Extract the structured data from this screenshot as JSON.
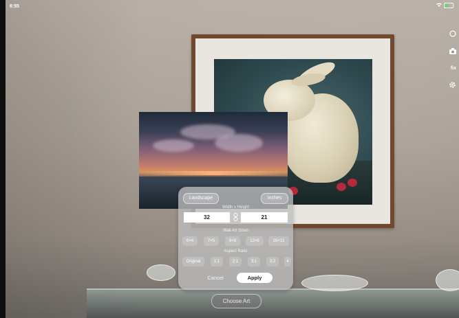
{
  "status_bar": {
    "time": "6:55"
  },
  "dialog": {
    "orientation_label": "Landscape",
    "units_label": "Inches",
    "size_section_label": "Width x Height",
    "width_value": "32",
    "height_value": "21",
    "wall_art_sizes_label": "Wall Art Sizes",
    "wall_art_sizes": [
      "6×4",
      "7×5",
      "8×8",
      "12×8",
      "16×12"
    ],
    "aspect_ratio_label": "Aspect Ratio",
    "aspect_ratios": [
      "Original",
      "1:1",
      "2:1",
      "3:1",
      "3:2",
      "4"
    ],
    "cancel_label": "Cancel",
    "apply_label": "Apply"
  },
  "choose_art_label": "Choose Art",
  "side_tools": {
    "label": "fix"
  },
  "icons": [
    "wifi-icon",
    "battery-icon",
    "refresh-icon",
    "camera-icon",
    "gear-icon",
    "link-icon"
  ]
}
